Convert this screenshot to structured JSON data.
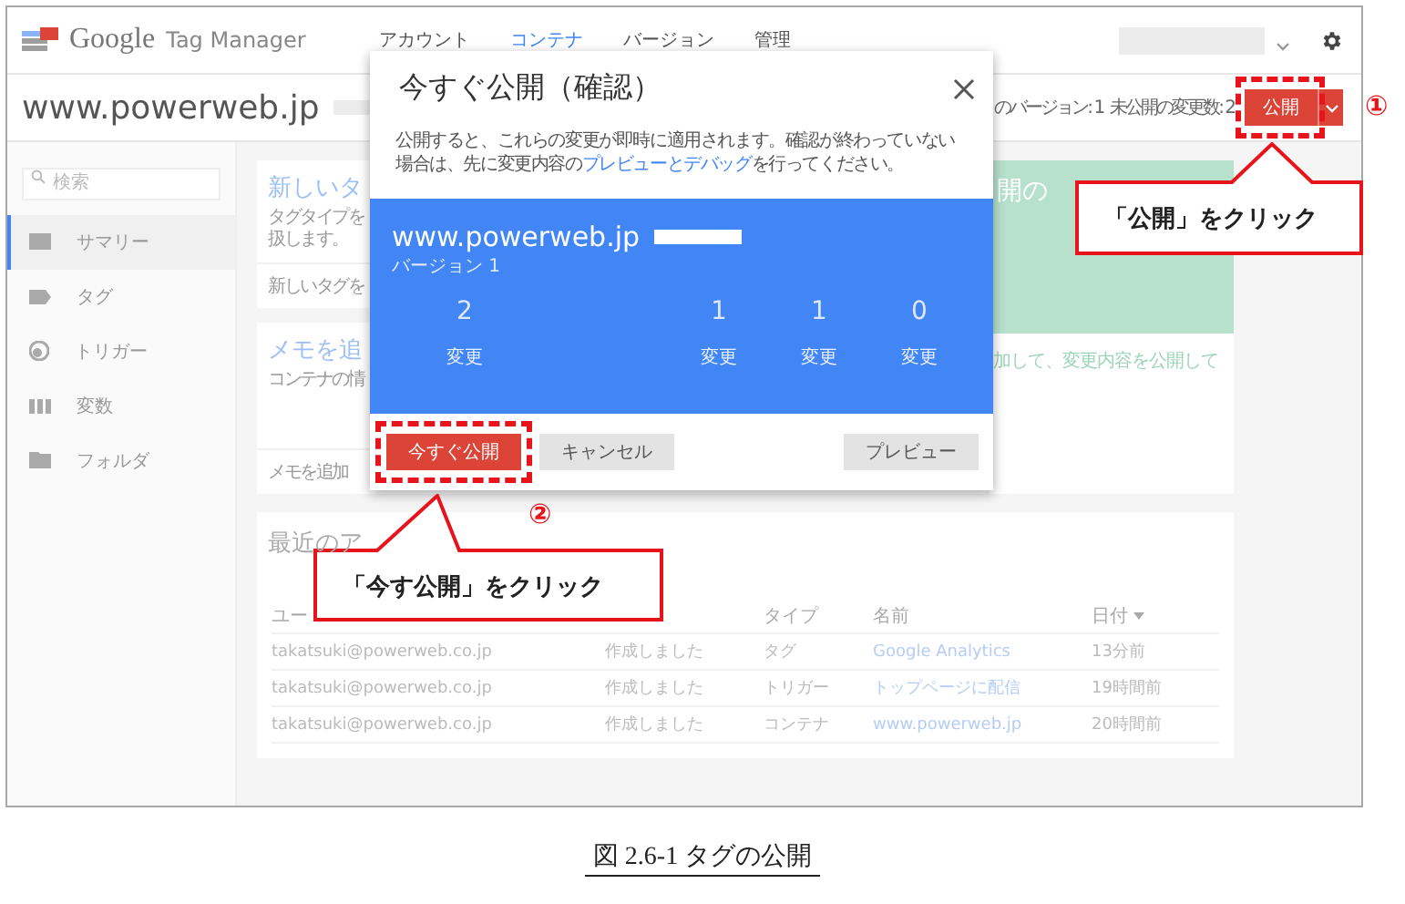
{
  "header": {
    "brand": "Google",
    "product": "Tag Manager",
    "nav": [
      {
        "label": "アカウント",
        "selected": false
      },
      {
        "label": "コンテナ",
        "selected": true
      },
      {
        "label": "バージョン",
        "selected": false
      },
      {
        "label": "管理",
        "selected": false
      }
    ]
  },
  "container_bar": {
    "name": "www.powerweb.jp",
    "version_fragment": "のバージョン: 1",
    "unpublished": "未公開の変更数: 2",
    "publish_button": "公開"
  },
  "sidebar": {
    "search_placeholder": "検索",
    "items": [
      {
        "label": "サマリー",
        "kind": "summary",
        "selected": true
      },
      {
        "label": "タグ",
        "kind": "tag",
        "selected": false
      },
      {
        "label": "トリガー",
        "kind": "trigger",
        "selected": false
      },
      {
        "label": "変数",
        "kind": "variable",
        "selected": false
      },
      {
        "label": "フォルダ",
        "kind": "folder",
        "selected": false
      }
    ]
  },
  "cards": {
    "new_tag": {
      "title": "新しいタ",
      "lines": [
        "タグタイプを",
        "扱します。"
      ],
      "footer": "新しいタグを"
    },
    "memo": {
      "title": "メモを追",
      "lines": [
        "コンテナの情"
      ],
      "footer": "メモを追加"
    },
    "publish": {
      "title": "開の",
      "text": "加して、変更内容を公開して"
    }
  },
  "activity": {
    "title": "最近のア",
    "columns": {
      "user": "ユー",
      "type": "タイプ",
      "name": "名前",
      "date": "日付"
    },
    "rows": [
      {
        "user": "takatsuki@powerweb.co.jp",
        "action": "作成しました",
        "type": "タグ",
        "name": "Google Analytics",
        "date": "13分前"
      },
      {
        "user": "takatsuki@powerweb.co.jp",
        "action": "作成しました",
        "type": "トリガー",
        "name": "トップページに配信",
        "date": "19時間前"
      },
      {
        "user": "takatsuki@powerweb.co.jp",
        "action": "作成しました",
        "type": "コンテナ",
        "name": "www.powerweb.jp",
        "date": "20時間前"
      }
    ]
  },
  "modal": {
    "title": "今すぐ公開（確認）",
    "text_before": "公開すると、これらの変更が即時に適用されます。確認が終わっていない場合は、先に変更内容の",
    "link": "プレビューとデバッグ",
    "text_after": "を行ってください。",
    "container": "www.powerweb.jp",
    "version": "バージョン 1",
    "stats": [
      {
        "value": "2",
        "label": "変更"
      },
      {
        "value": "1",
        "label": "変更"
      },
      {
        "value": "1",
        "label": "変更"
      },
      {
        "value": "0",
        "label": "変更"
      }
    ],
    "buttons": {
      "publish": "今すぐ公開",
      "cancel": "キャンセル",
      "preview": "プレビュー"
    }
  },
  "annotations": [
    {
      "step": "①",
      "text": "「公開」をクリック"
    },
    {
      "step": "②",
      "text": "「今す公開」をクリック"
    }
  ],
  "caption": "図 2.6-1 タグの公開"
}
